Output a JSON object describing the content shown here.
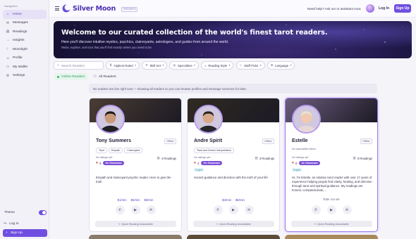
{
  "sidebar": {
    "heading": "Navigation",
    "items": [
      {
        "label": "Home",
        "icon": "home-icon",
        "glyph": "⌂",
        "active": true
      },
      {
        "label": "Messages",
        "icon": "message-icon",
        "glyph": "✉",
        "active": false
      },
      {
        "label": "Readings",
        "icon": "readings-icon",
        "glyph": "▤",
        "active": false
      },
      {
        "label": "Insights",
        "icon": "insights-icon",
        "glyph": "◔",
        "active": false
      },
      {
        "label": "Moonlight",
        "icon": "moon-icon",
        "glyph": "☾",
        "active": false
      },
      {
        "label": "Profile",
        "icon": "user-icon",
        "glyph": "☺",
        "active": false
      },
      {
        "label": "My Wallet",
        "icon": "wallet-icon",
        "glyph": "▭",
        "active": false
      },
      {
        "label": "Settings",
        "icon": "gear-icon",
        "glyph": "⚙",
        "active": false
      }
    ],
    "theme_label": "Theme",
    "login_label": "Log In",
    "signup_label": "Sign Up"
  },
  "header": {
    "brand": "Silver Moon",
    "beta": "OPEN BETA",
    "aura_prompt": "Need help? Ask our AI assistant Aura",
    "login": "Log In",
    "signup": "Sign Up"
  },
  "hero": {
    "title": "Welcome to our curated collection of the world's finest tarot readers.",
    "subtitle": "Here you'll discover intuitive mystics, psychics, clairvoyants, astrologers, and guides from around the world.",
    "tagline": "Relax, explore, and trust that you'll find exactly where you need to be."
  },
  "filters": {
    "search_placeholder": "Search Readers",
    "items": [
      {
        "label": "Highest Rated",
        "icon": "sort-icon",
        "glyph": "⇅"
      },
      {
        "label": "Skill Set",
        "icon": "skill-icon",
        "glyph": "✦"
      },
      {
        "label": "Specialties",
        "icon": "specialties-icon",
        "glyph": "◎"
      },
      {
        "label": "Reading Style",
        "icon": "style-icon",
        "glyph": "◐"
      },
      {
        "label": "Staff Picks",
        "icon": "star-icon",
        "glyph": "☆"
      },
      {
        "label": "Language",
        "icon": "globe-icon",
        "glyph": "⊕"
      }
    ]
  },
  "tabs": {
    "online": "Online Readers",
    "all": "All Readers"
  },
  "notice": "No readers are live right now — showing all readers so you can browse profiles and message someone for later.",
  "readers": [
    {
      "name": "Tony Summers",
      "status": "Offline",
      "specialties": [
        "Tarot",
        "Empath",
        "Clairvoyant"
      ],
      "no_specialties": "",
      "ratings": "No ratings yet",
      "readings": "4 Readings",
      "likes": "0",
      "showcase": "On Showcase",
      "language": "",
      "bio": "Empath and clairvoyant psychic reader. Here to give the truth",
      "prices": [
        "$1/min",
        "$5/min",
        "$5/min"
      ],
      "rate_not_set": "",
      "quick": "Quick Reading Unavailable",
      "banner": "#4a3d33"
    },
    {
      "name": "Andre Spirit",
      "status": "Offline",
      "specialties": [
        "Tarot and Dream Interpretation"
      ],
      "no_specialties": "",
      "ratings": "No ratings yet",
      "readings": "3 Readings",
      "likes": "4",
      "showcase": "On Showcase",
      "language": "English",
      "bio": "Honest guidance and direction with the truth of your life",
      "prices": [
        "$4/min",
        "$6/min"
      ],
      "rate_not_set": "",
      "quick": "Quick Reading Unavailable",
      "banner": "#2f2a22"
    },
    {
      "name": "Estelle",
      "status": "Offline",
      "specialties": [],
      "no_specialties": "No specialties listed",
      "ratings": "No ratings yet",
      "readings": "0 Readings",
      "likes": "0",
      "showcase": "On Showcase",
      "language": "English",
      "bio": "Hi, I'm Estelle, an intuitive tarot reader with over 17 years of experience helping people find clarity, healing, and direction through tarot and spiritual guidance. My readings are honest, compassionate,...",
      "prices": [],
      "rate_not_set": "Rate not set",
      "quick": "Quick Reading Unavailable",
      "banner": "#6b5d7e"
    }
  ]
}
